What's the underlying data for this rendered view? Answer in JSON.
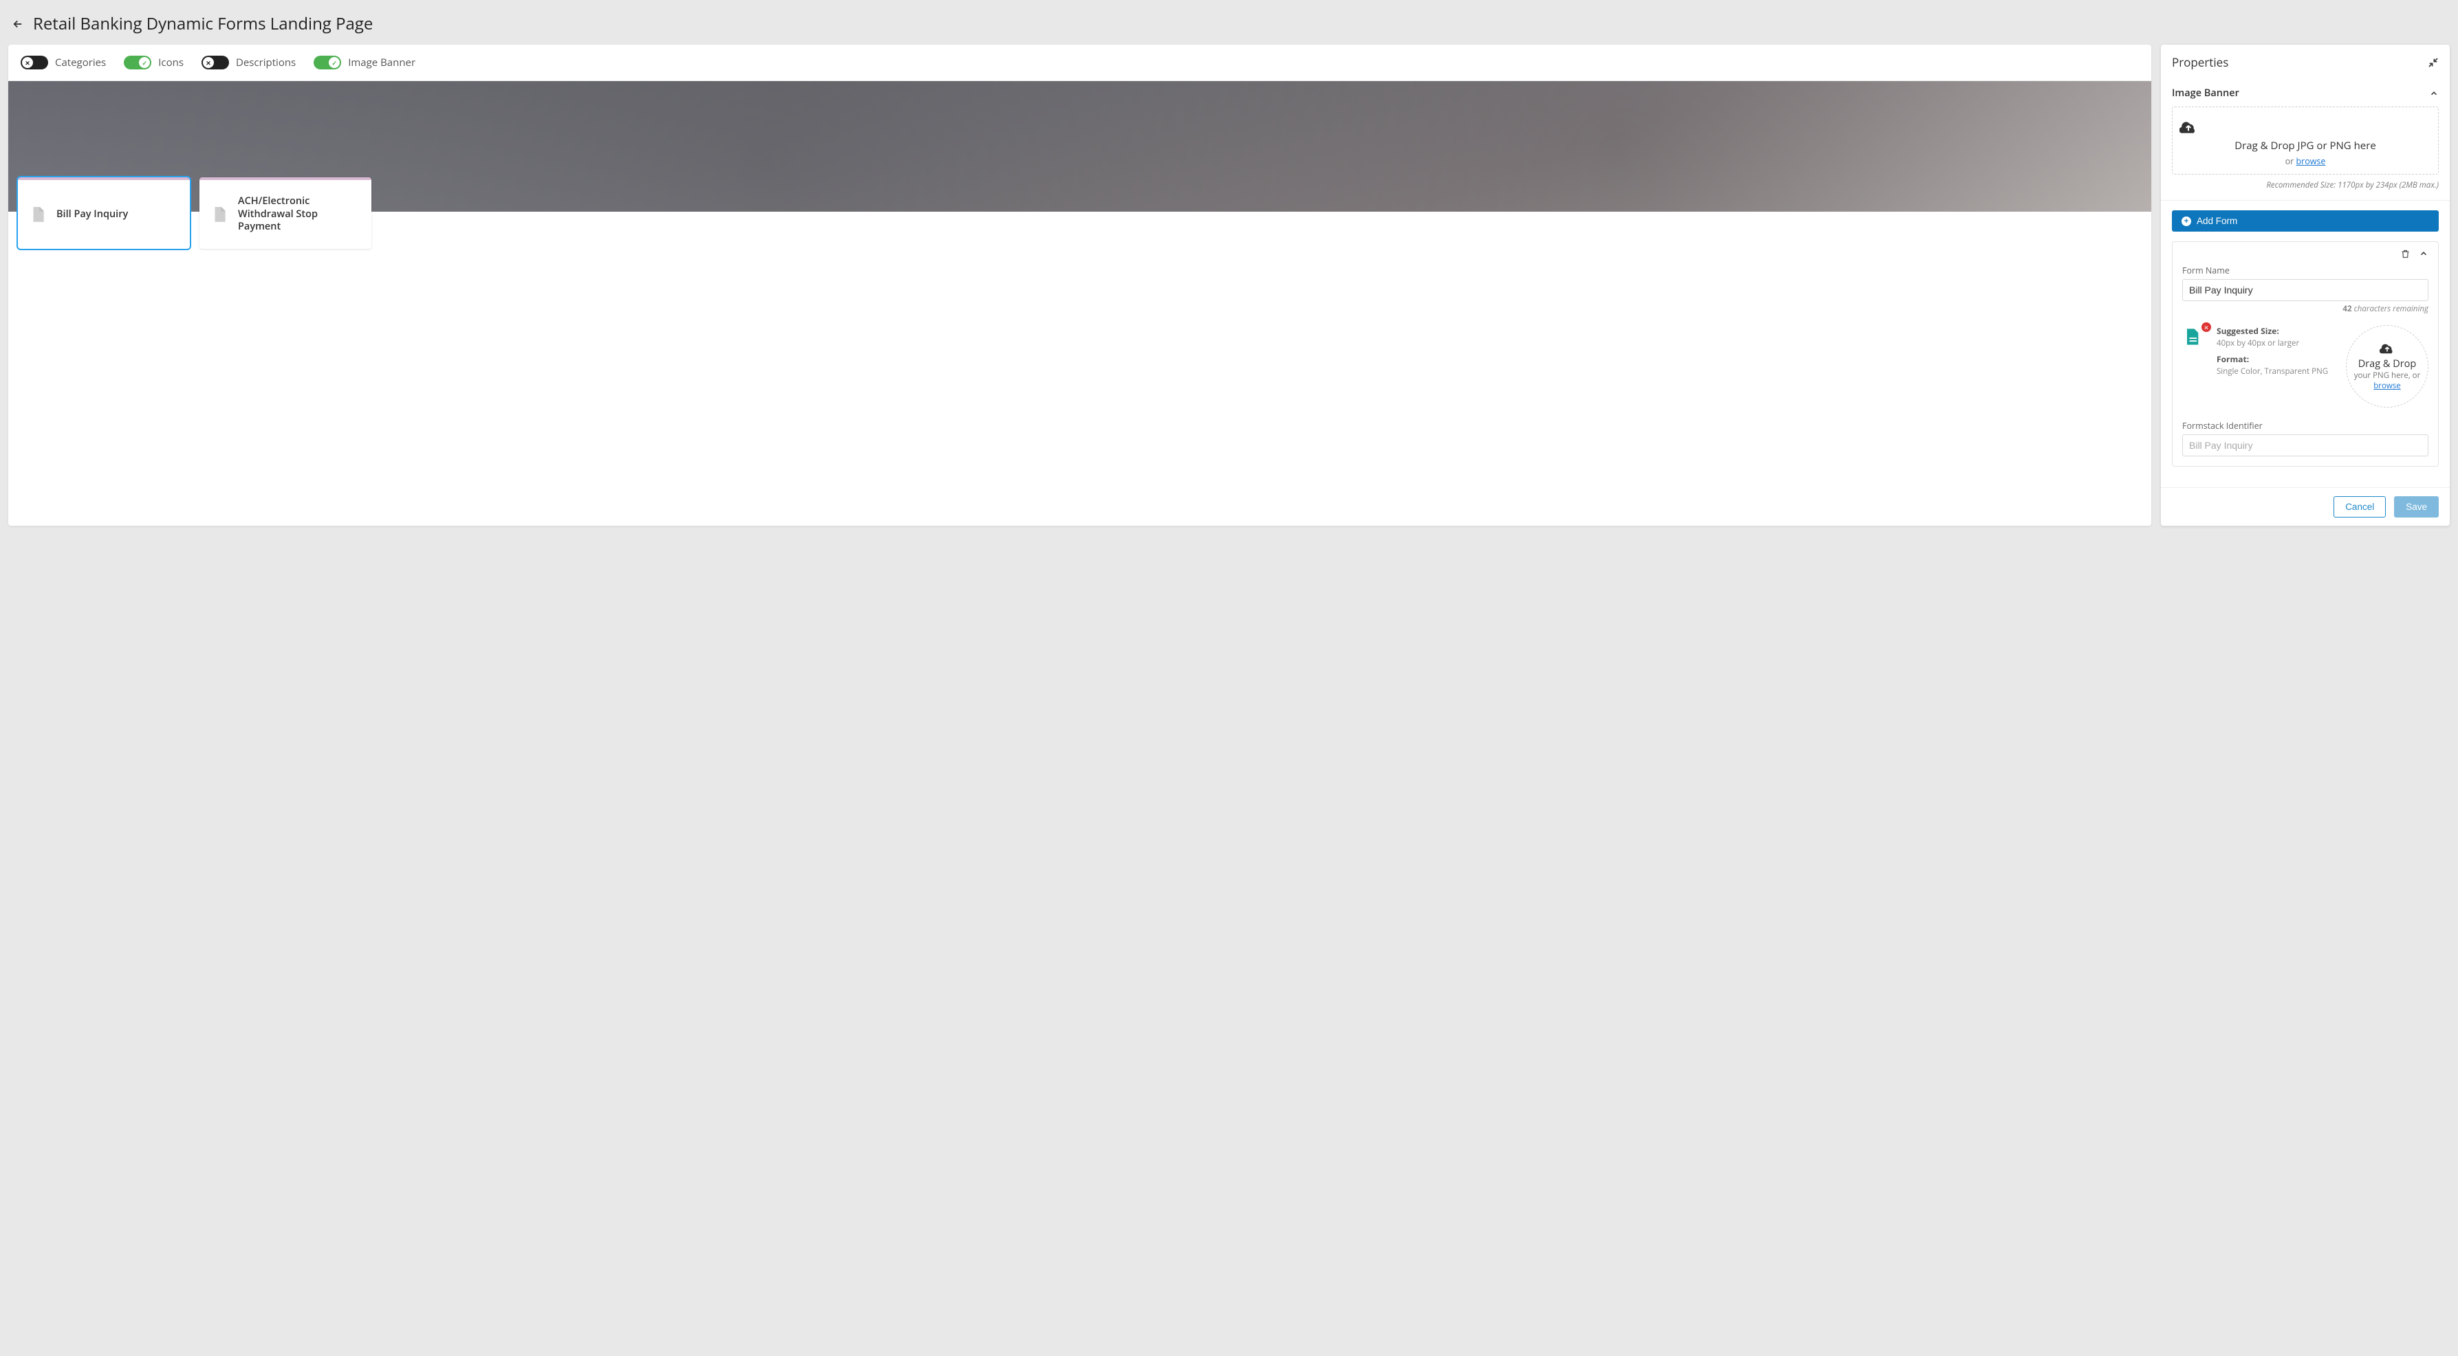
{
  "header": {
    "title": "Retail Banking Dynamic Forms Landing Page"
  },
  "toolbar": {
    "toggles": [
      {
        "label": "Categories",
        "on": false
      },
      {
        "label": "Icons",
        "on": true
      },
      {
        "label": "Descriptions",
        "on": false
      },
      {
        "label": "Image Banner",
        "on": true
      }
    ]
  },
  "cards": [
    {
      "title": "Bill Pay Inquiry",
      "selected": true
    },
    {
      "title": "ACH/Electronic Withdrawal Stop Payment",
      "selected": false
    }
  ],
  "panel": {
    "title": "Properties",
    "image_banner": {
      "section_title": "Image Banner",
      "dz_title": "Drag & Drop JPG or PNG here",
      "dz_or": "or ",
      "dz_browse": "browse",
      "recommended": "Recommended Size: 1170px by 234px (2MB max.)"
    },
    "add_form_label": "Add Form",
    "form": {
      "name_label": "Form Name",
      "name_value": "Bill Pay Inquiry",
      "remaining_num": "42",
      "remaining_txt": " characters remaining",
      "size_label": "Suggested Size:",
      "size_value": "40px by 40px or larger",
      "fmt_label": "Format:",
      "fmt_value": "Single Color, Transparent PNG",
      "drop_title": "Drag & Drop",
      "drop_sub": "your PNG here, or ",
      "drop_browse": "browse",
      "fs_label": "Formstack Identifier",
      "fs_placeholder": "Bill Pay Inquiry"
    },
    "footer": {
      "cancel": "Cancel",
      "save": "Save"
    }
  }
}
